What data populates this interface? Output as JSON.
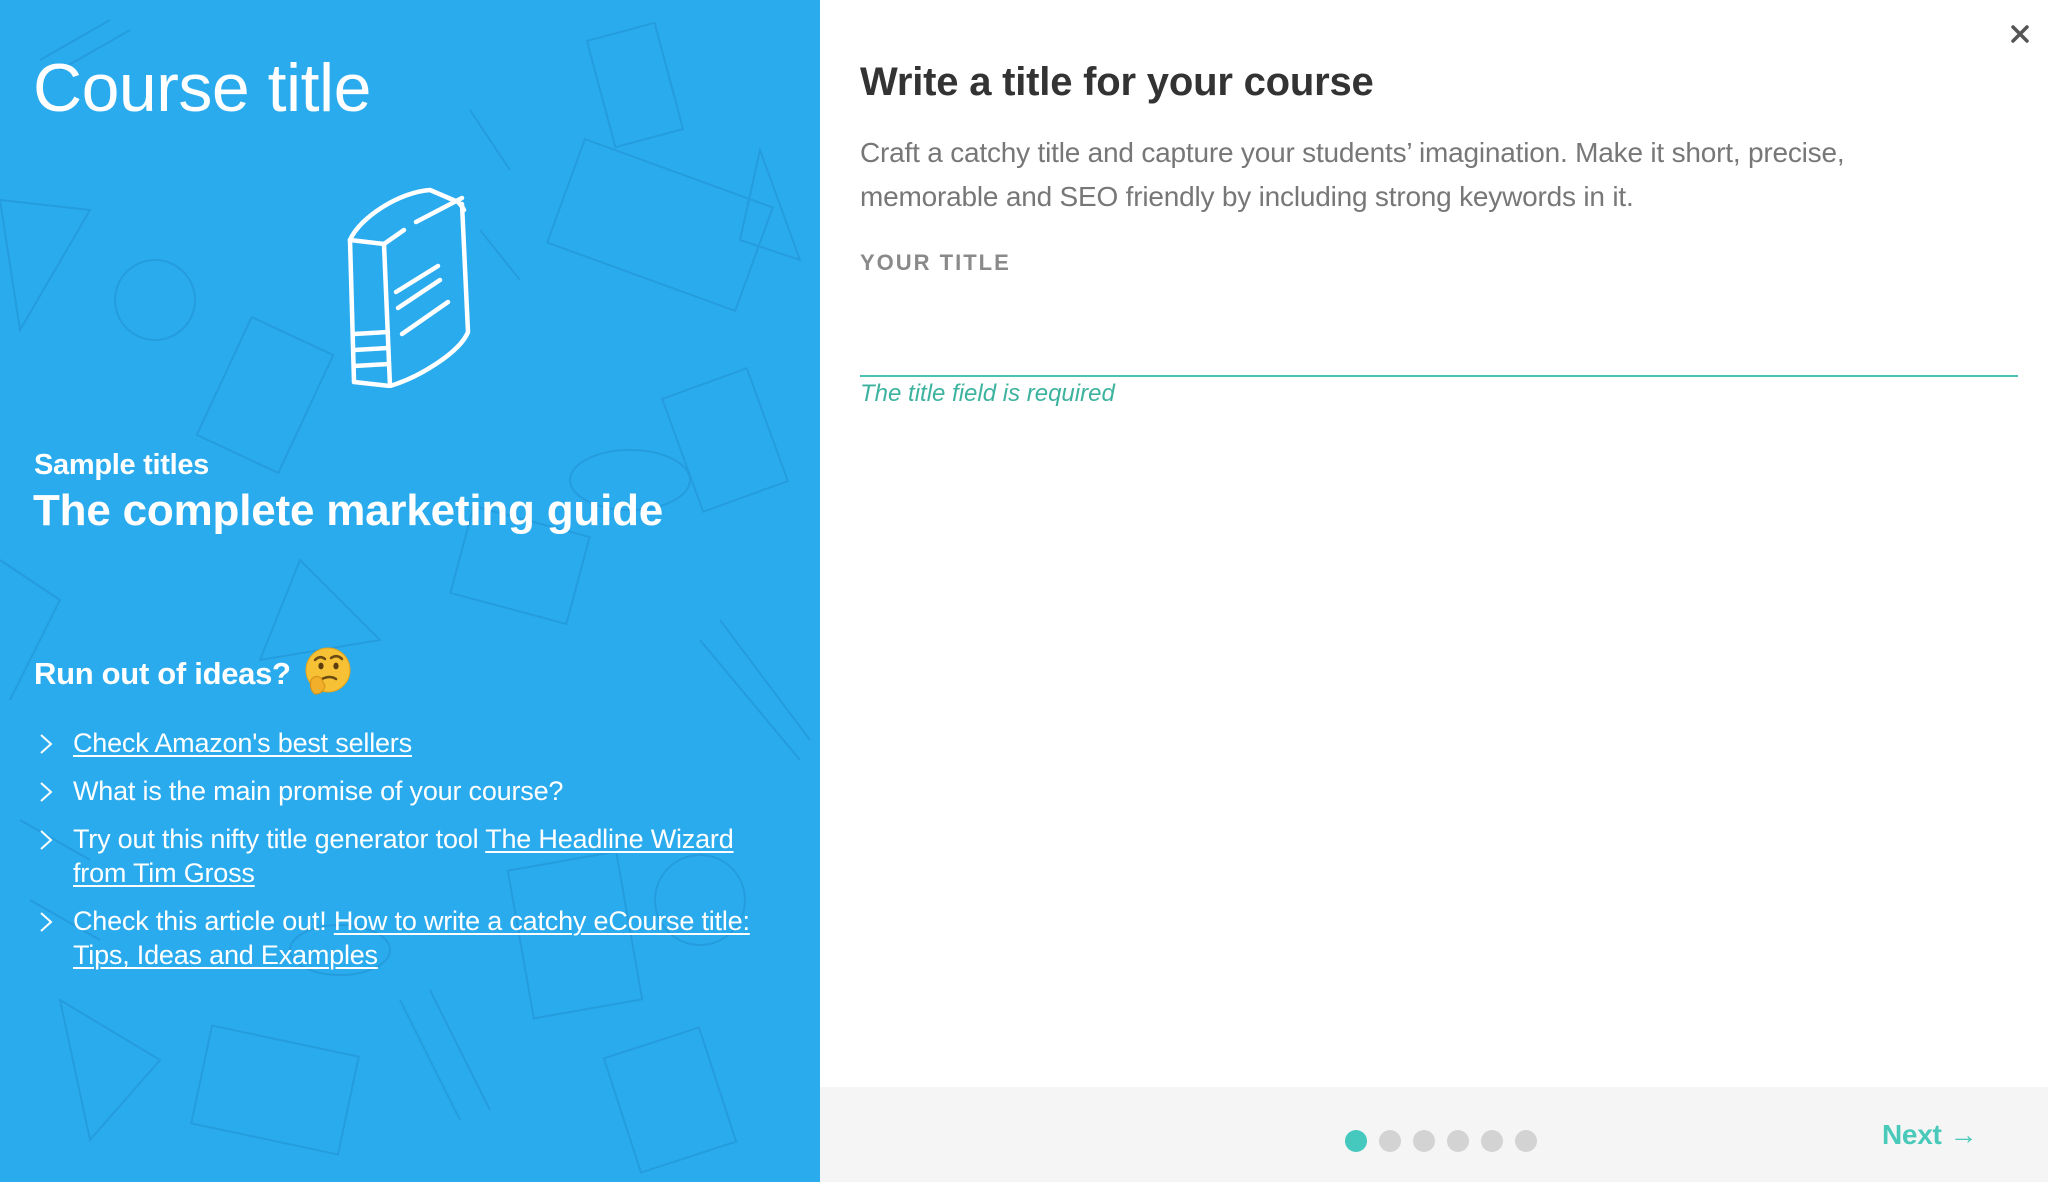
{
  "left_panel": {
    "title": "Course title",
    "illustration_icon": "book-icon",
    "sample_label": "Sample titles",
    "sample_value": "The complete marketing guide",
    "ideas_heading": "Run out of ideas?",
    "ideas_emoji": "thinking-face-emoji",
    "ideas": [
      {
        "text": "",
        "link": "Check Amazon's best sellers"
      },
      {
        "text": "What is the main promise of your course?",
        "link": ""
      },
      {
        "text": "Try out this nifty title generator tool ",
        "link": "The Headline Wizard from Tim Gross"
      },
      {
        "text": "Check this article out! ",
        "link": "How to write a catchy eCourse title: Tips, Ideas and Examples"
      }
    ],
    "background_color": "#2aabee"
  },
  "right_panel": {
    "heading": "Write a title for your course",
    "description": "Craft a catchy title and capture your students’ imagination. Make it short, precise, memorable and SEO friendly by including strong keywords in it.",
    "field_label": "YOUR TITLE",
    "field_value": "",
    "error_message": "The title field is required",
    "close_icon": "close-icon",
    "accent_color": "#48c9b9"
  },
  "footer": {
    "steps_total": 6,
    "current_step": 1,
    "next_label": "Next",
    "next_arrow": "→"
  }
}
